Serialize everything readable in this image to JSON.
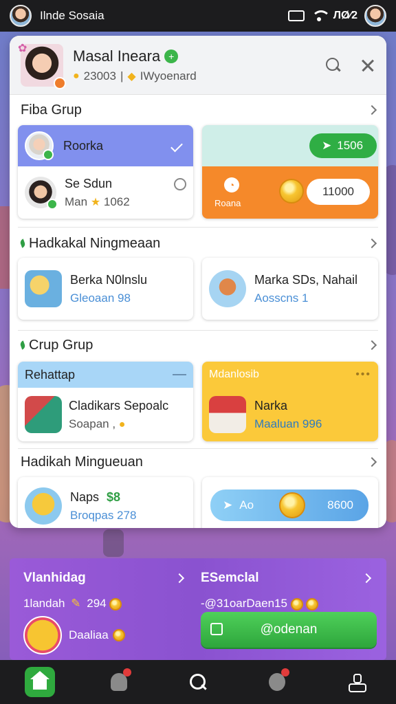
{
  "status_bar": {
    "title": "Ilnde Sosaia",
    "signal_text": "ЛØ∕2"
  },
  "header": {
    "name": "Masal Ineara",
    "stat_left": "23003",
    "stat_right": "IWyoenard"
  },
  "section1": {
    "title": "Fiba Grup",
    "card_a_top": {
      "name": "Roorka"
    },
    "card_a_bottom": {
      "name": "Se Sdun",
      "sub": "Man",
      "sub_value": "1062"
    },
    "card_b": {
      "badge": "1506",
      "label": "Roana",
      "value": "11000"
    }
  },
  "section2": {
    "title": "Hadkakal Ningmeaan",
    "card_a": {
      "name": "Berka N0lnslu",
      "sub": "Gleoaan 98"
    },
    "card_b": {
      "name": "Marka SDs, Nahail",
      "sub": "Aosscns 1"
    }
  },
  "section3": {
    "title": "Crup Grup",
    "card_a": {
      "header": "Rehattap",
      "name": "Cladikars Sepoalc",
      "sub": "Soapan ,"
    },
    "card_b": {
      "header": "Mdanlosib",
      "name": "Narka",
      "sub": "Maaluan 996"
    }
  },
  "section4": {
    "title": "Hadikah Mingueuan",
    "card_a": {
      "name": "Naps",
      "name_value": "$8",
      "sub": "Broqpas 278"
    },
    "card_b": {
      "label": "Ao",
      "value": "8600"
    }
  },
  "promo": {
    "left_title": "Vlanhidag",
    "left_line": "1landah",
    "left_line_value": "294",
    "left_item": "Daaliaa",
    "right_title": "ESemclal",
    "right_line": "-@31oarDaen15",
    "button_label": "@odenan"
  },
  "colors": {
    "accent_green": "#2faa3e",
    "accent_orange": "#f5892a",
    "accent_blue": "#7f8ef0",
    "accent_yellow": "#f7c531",
    "promo_purple": "#9055d6"
  }
}
